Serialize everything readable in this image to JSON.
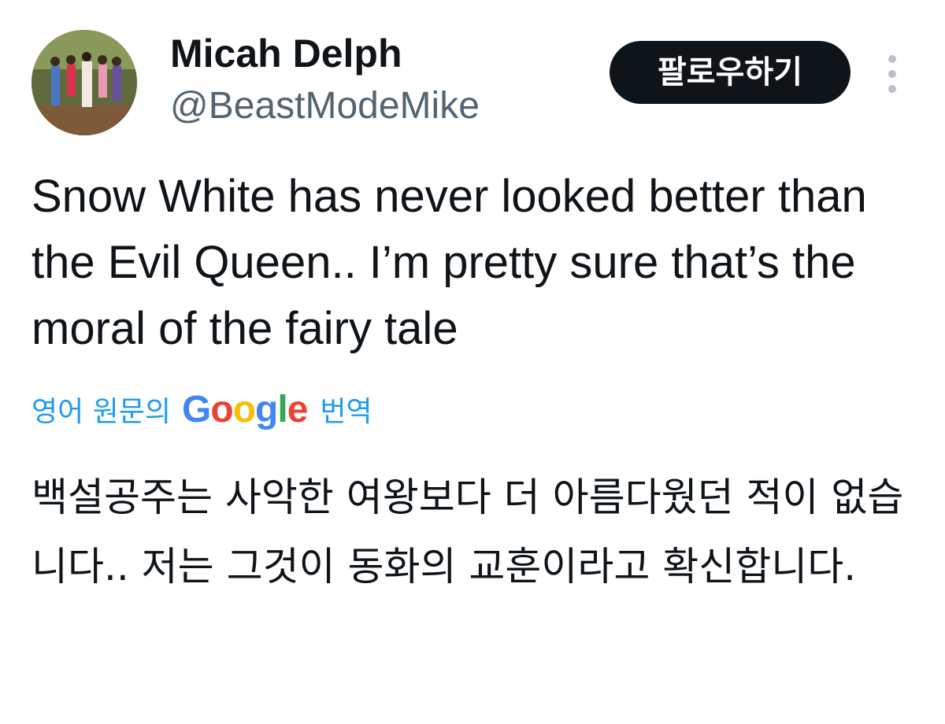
{
  "author": {
    "display_name": "Micah Delph",
    "handle": "@BeastModeMike",
    "avatar": "avatar-photo-group"
  },
  "actions": {
    "follow_label": "팔로우하기",
    "more_icon": "more-vertical-icon"
  },
  "tweet": {
    "text": "Snow White has never looked better than the Evil Queen.. I’m pretty sure that’s the moral of the fairy tale"
  },
  "translation": {
    "prefix": "영어 원문의",
    "provider": "Google",
    "suffix": "번역",
    "text": "백설공주는 사악한 여왕보다 더 아름다웠던 적이 없습니다.. 저는 그것이 동화의 교훈이라고 확신합니다."
  },
  "colors": {
    "link": "#1d9bf0",
    "text": "#0f1419",
    "secondary": "#536471",
    "button_bg": "#0f1419",
    "google": [
      "#4285F4",
      "#EA4335",
      "#FBBC05",
      "#4285F4",
      "#34A853",
      "#EA4335"
    ]
  }
}
